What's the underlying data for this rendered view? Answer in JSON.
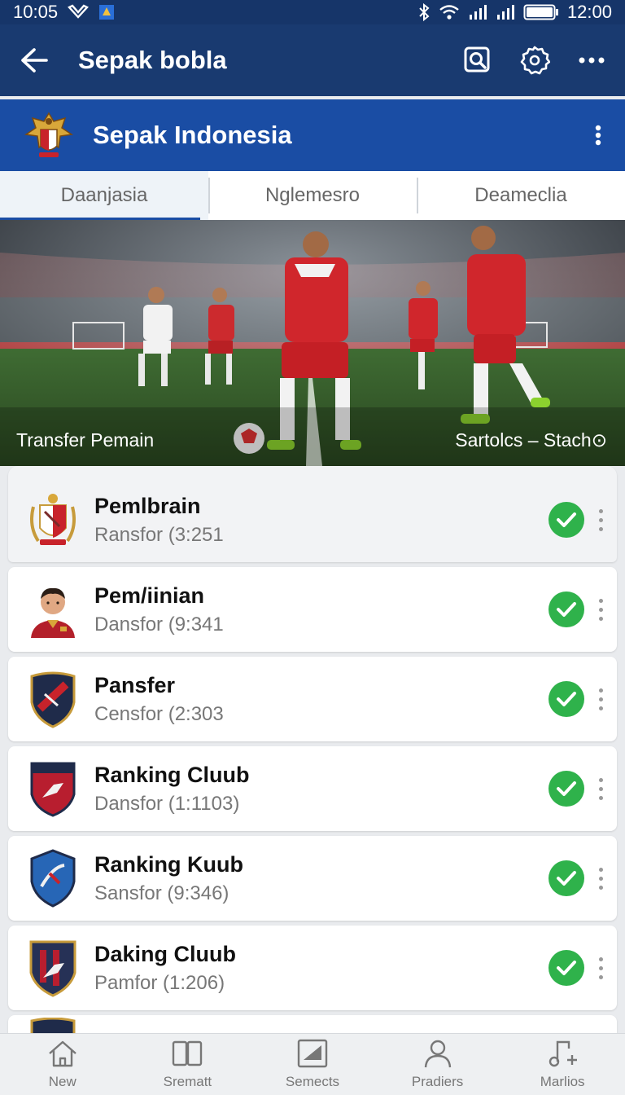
{
  "status_bar": {
    "time_left": "10:05",
    "time_right": "12:00"
  },
  "app_bar": {
    "title": "Sepak bobla"
  },
  "league": {
    "name": "Sepak Indonesia"
  },
  "tabs": [
    {
      "label": "Daanjasia",
      "active": true
    },
    {
      "label": "Nglemesro",
      "active": false
    },
    {
      "label": "Deameclia",
      "active": false
    }
  ],
  "hero": {
    "caption_left": "Transfer Pemain",
    "caption_right": "Sartolcs – Stach⊙"
  },
  "items": [
    {
      "name": "Pemlbrain",
      "sub": "Ransfor (3:251",
      "status": "check",
      "crest": "crest-gold-red"
    },
    {
      "name": "Pem/iinian",
      "sub": "Dansfor (9:341",
      "status": "check",
      "crest": "player-portrait"
    },
    {
      "name": "Pansfer",
      "sub": "Censfor (2:303",
      "status": "check",
      "crest": "crest-navy-red"
    },
    {
      "name": "Ranking Cluub",
      "sub": "Dansfor (1:1103)",
      "status": "check",
      "crest": "crest-red-navy"
    },
    {
      "name": "Ranking Kuub",
      "sub": "Sansfor (9:346)",
      "status": "check",
      "crest": "crest-blue"
    },
    {
      "name": "Daking Cluub",
      "sub": "Pamfor (1:206)",
      "status": "check",
      "crest": "crest-gold-navy"
    }
  ],
  "bottom_nav": [
    {
      "label": "New",
      "icon": "home-icon"
    },
    {
      "label": "Srematt",
      "icon": "book-icon"
    },
    {
      "label": "Semects",
      "icon": "media-icon"
    },
    {
      "label": "Pradiers",
      "icon": "person-icon"
    },
    {
      "label": "Marlios",
      "icon": "music-icon"
    }
  ],
  "colors": {
    "status_bar": "#163569",
    "app_bar": "#193a70",
    "league_bar": "#1a4da4",
    "check": "#2fb24b"
  }
}
